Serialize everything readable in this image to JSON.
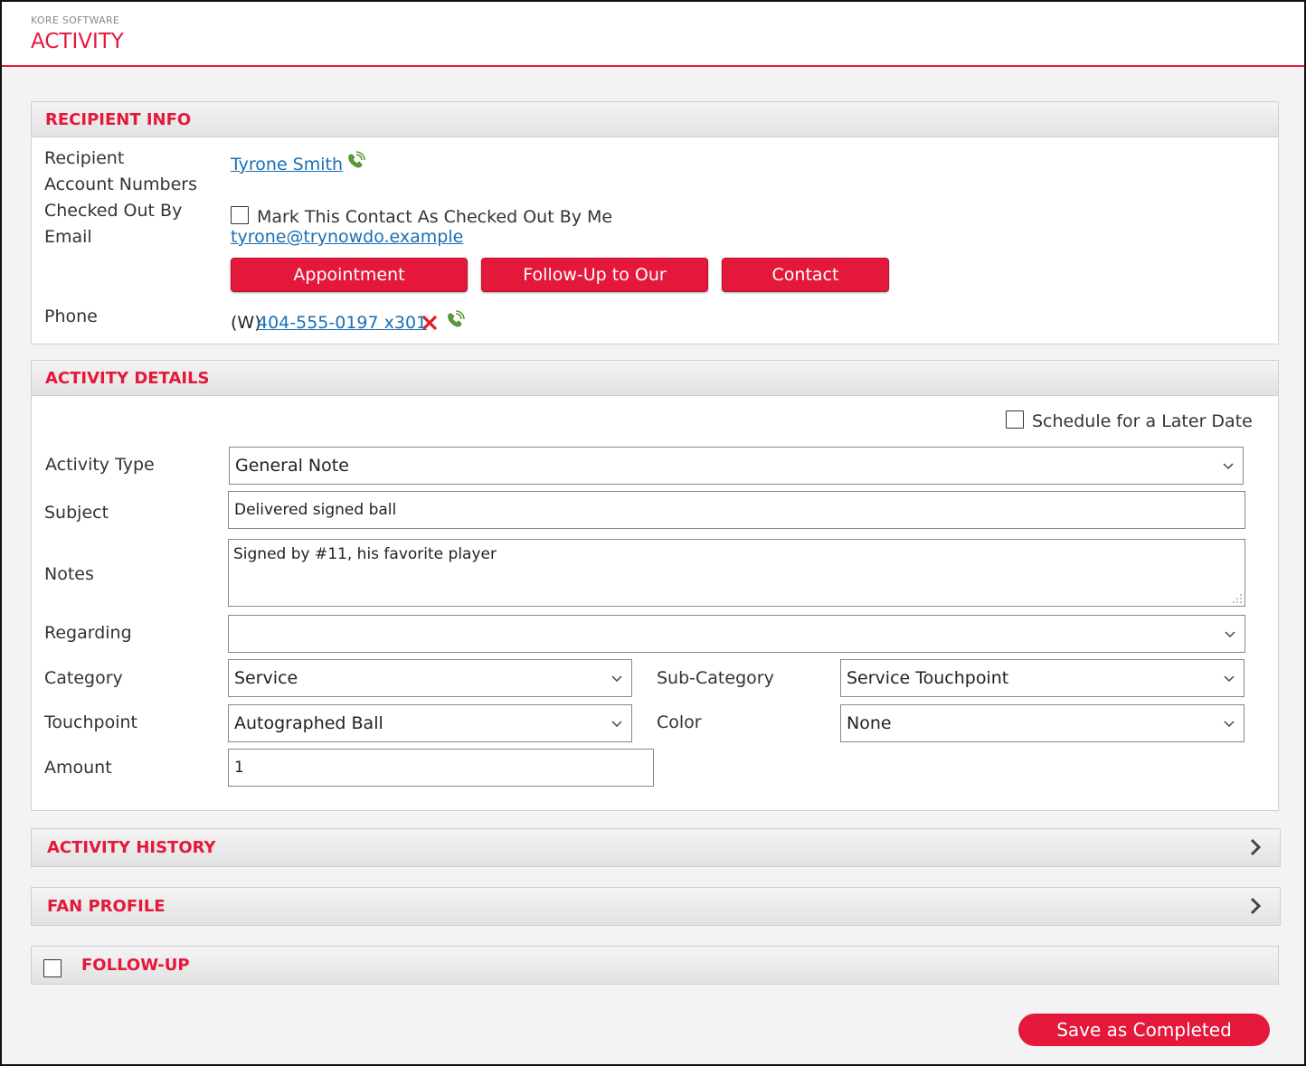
{
  "app": {
    "brand": "KORE SOFTWARE",
    "title": "ACTIVITY"
  },
  "recipient_info": {
    "title": "RECIPIENT INFO",
    "labels": {
      "recipient": "Recipient",
      "account_numbers": "Account Numbers",
      "checked_out_by": "Checked Out By",
      "email": "Email",
      "phone": "Phone"
    },
    "recipient_name": "Tyrone Smith",
    "checkout_label": "Mark This Contact As Checked Out By Me",
    "email": "tyrone@trynowdo.example",
    "email_templates": [
      "Appointment Confirmation",
      "Follow-Up to Our Meeting",
      "Contact Reconnect"
    ],
    "phone_prefix": "(W)",
    "phone_number": "404-555-0197 x301"
  },
  "activity_details": {
    "title": "ACTIVITY DETAILS",
    "schedule_label": "Schedule for a Later Date",
    "labels": {
      "activity_type": "Activity Type",
      "subject": "Subject",
      "notes": "Notes",
      "regarding": "Regarding",
      "category": "Category",
      "sub_category": "Sub-Category",
      "touchpoint": "Touchpoint",
      "color": "Color",
      "amount": "Amount"
    },
    "values": {
      "activity_type": "General Note",
      "subject": "Delivered signed ball",
      "notes": "Signed by #11, his favorite player",
      "regarding": "",
      "category": "Service",
      "sub_category": "Service Touchpoint",
      "touchpoint": "Autographed Ball",
      "color": "None",
      "amount": "1"
    }
  },
  "sections": {
    "activity_history": "ACTIVITY HISTORY",
    "fan_profile": "FAN PROFILE",
    "follow_up": "FOLLOW-UP"
  },
  "footer": {
    "save_label": "Save as Completed"
  },
  "colors": {
    "accent": "#e4183a",
    "link": "#1a6fb5"
  },
  "icons": [
    "phone-call-icon",
    "delete-x-icon",
    "chevron-right-icon",
    "dropdown-caret-icon"
  ]
}
